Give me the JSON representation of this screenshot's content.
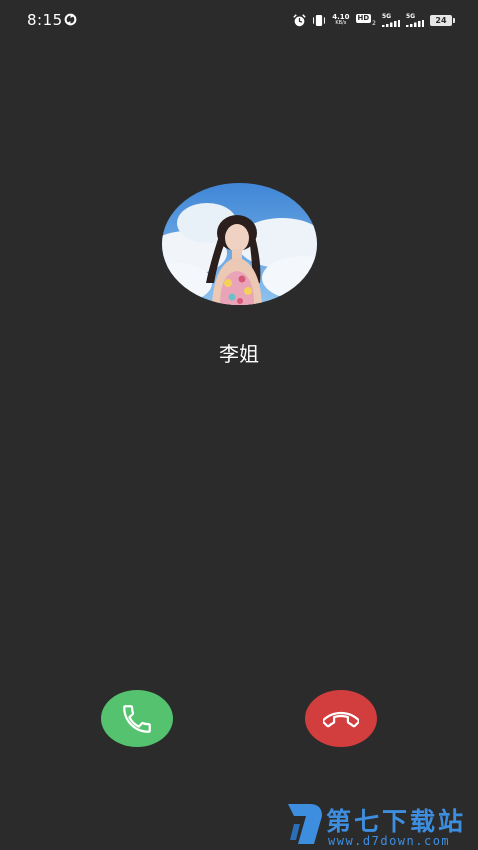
{
  "status_bar": {
    "time": "8:15",
    "net_speed_value": "4.10",
    "net_speed_unit": "KB/s",
    "hd_label": "HD",
    "hd_sub": "2",
    "sim1_label": "5G",
    "sim2_label": "5G",
    "battery_level": "24",
    "icons": [
      "sync-icon",
      "alarm-icon",
      "vibrate-icon",
      "signal-icon",
      "battery-icon"
    ]
  },
  "caller": {
    "name": "李姐",
    "avatar": "photo of a woman under a blue sky with clouds"
  },
  "actions": {
    "answer_icon": "phone-icon",
    "decline_icon": "phone-hangup-icon"
  },
  "watermark": {
    "title": "第七下载站",
    "url": "www.d7down.com"
  },
  "colors": {
    "background": "#2b2b2b",
    "answer": "#55c26f",
    "decline": "#d23d3d",
    "watermark": "#3e8ee0"
  }
}
